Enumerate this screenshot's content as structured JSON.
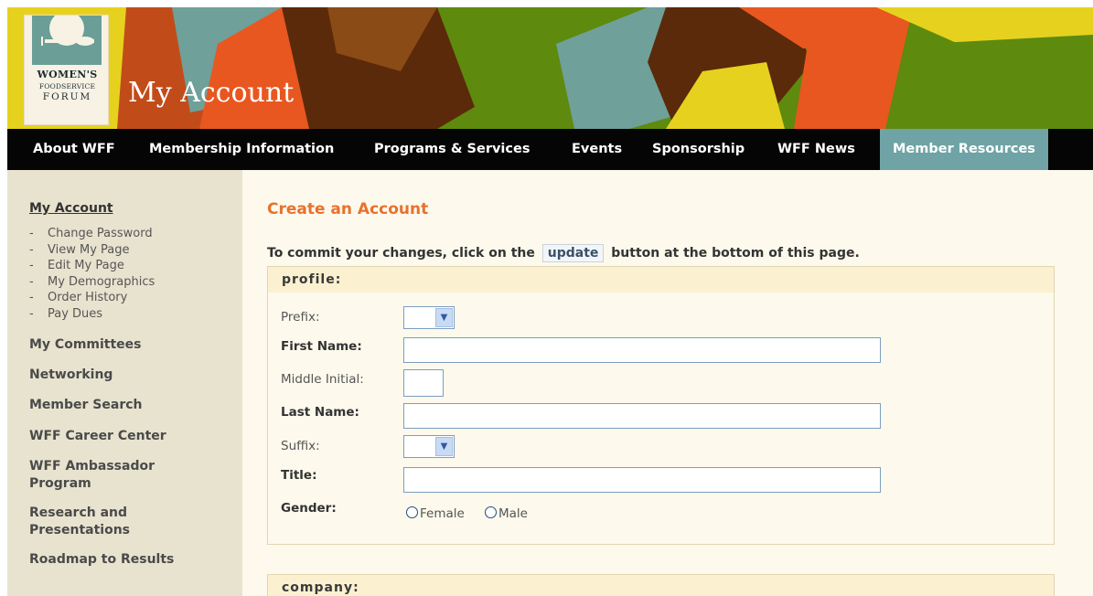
{
  "branding": {
    "logo_line1": "WOMEN'S",
    "logo_line2": "FOODSERVICE",
    "logo_line3": "FORUM",
    "page_heading": "My Account"
  },
  "nav": {
    "items": [
      "About WFF",
      "Membership Information",
      "Programs & Services",
      "Events",
      "Sponsorship",
      "WFF News",
      "Member Resources"
    ],
    "active": "Member Resources"
  },
  "sidebar": {
    "account": {
      "label": "My Account",
      "subitems": [
        "Change Password",
        "View My Page",
        "Edit My Page",
        "My Demographics",
        "Order History",
        "Pay Dues"
      ]
    },
    "links": [
      "My Committees",
      "Networking",
      "Member Search",
      "WFF Career Center",
      "WFF Ambassador Program",
      "Research and Presentations",
      "Roadmap to Results"
    ]
  },
  "main": {
    "title": "Create an Account",
    "instructions_pre": "To commit your changes, click on the",
    "update_label": "update",
    "instructions_post": "button at the bottom of this page.",
    "profile": {
      "heading": "profile:",
      "prefix_label": "Prefix:",
      "first_name_label": "First Name:",
      "middle_initial_label": "Middle Initial:",
      "last_name_label": "Last Name:",
      "suffix_label": "Suffix:",
      "title_label": "Title:",
      "gender_label": "Gender:",
      "gender_female": "Female",
      "gender_male": "Male"
    },
    "company": {
      "heading": "company:"
    }
  },
  "colors": {
    "nav_bg": "#050505",
    "nav_active": "#6fa3a5",
    "title_orange": "#e8712e",
    "sidebar_bg": "#e8e3cf",
    "main_bg": "#fdf9ec",
    "section_head_bg": "#fbf1d0"
  }
}
